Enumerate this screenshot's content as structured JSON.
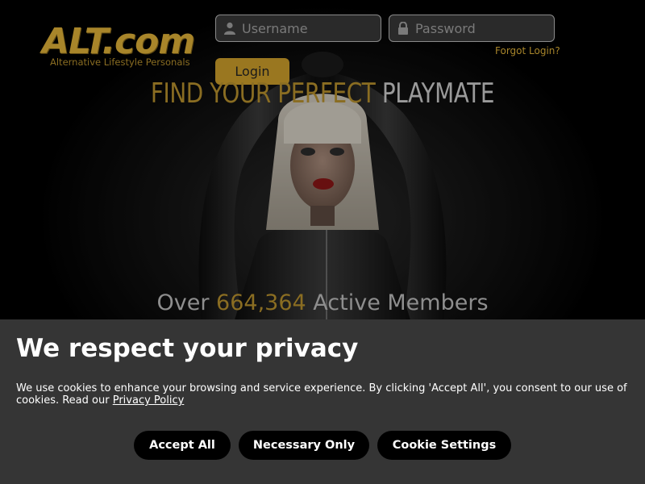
{
  "logo": {
    "brand": "ALT.com",
    "tagline": "Alternative Lifestyle Personals"
  },
  "login": {
    "username_placeholder": "Username",
    "password_placeholder": "Password",
    "username_value": "",
    "password_value": "",
    "forgot_label": "Forgot Login?",
    "login_label": "Login"
  },
  "hero": {
    "headline_part1": "FIND YOUR PERFECT",
    "headline_part2": "PLAYMATE",
    "members_prefix": "Over",
    "members_count": "664,364",
    "members_suffix": "Active Members"
  },
  "cookie": {
    "title": "We respect your privacy",
    "text": "We use cookies to enhance your browsing and service experience. By clicking 'Accept All', you consent to our use of cookies. Read our",
    "policy_link": "Privacy Policy",
    "accept_all": "Accept All",
    "necessary_only": "Necessary Only",
    "settings": "Cookie Settings"
  },
  "colors": {
    "accent_gold": "#a8852a",
    "banner_bg": "#353535",
    "button_bg": "#000000"
  },
  "icons": {
    "username": "user-icon",
    "password": "lock-icon"
  }
}
